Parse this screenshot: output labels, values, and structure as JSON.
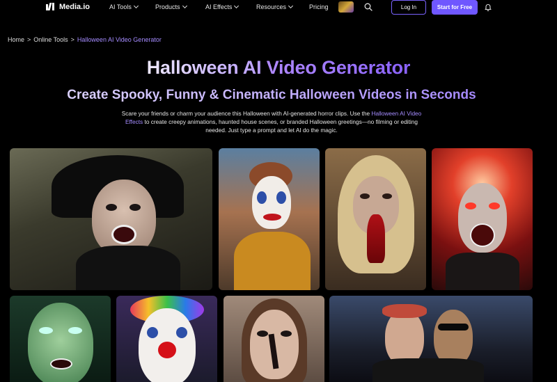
{
  "nav": {
    "brand": "Media.io",
    "items": [
      {
        "label": "AI Tools",
        "dropdown": true
      },
      {
        "label": "Products",
        "dropdown": true
      },
      {
        "label": "AI Effects",
        "dropdown": true
      },
      {
        "label": "Resources",
        "dropdown": true
      },
      {
        "label": "Pricing",
        "dropdown": false
      }
    ],
    "login_label": "Log In",
    "start_label": "Start for Free"
  },
  "breadcrumb": {
    "home": "Home",
    "sep": ">",
    "section": "Online Tools",
    "current": "Halloween AI Video Generator"
  },
  "hero": {
    "title_part1": "Halloween AI ",
    "title_part2": "Video Generator",
    "subtitle": "Create Spooky, Funny & Cinematic Halloween Videos in Seconds",
    "desc_before": "Scare your friends or charm your audience this Halloween with AI-generated horror clips. Use the ",
    "desc_link": "Halloween AI Video Effects",
    "desc_after": " to create creepy animations, haunted house scenes, or branded Halloween greetings—no filming or editing needed. Just type a prompt and let AI do the magic."
  },
  "colors": {
    "accent": "#6f57ff",
    "link": "#a58cff",
    "background": "#000000"
  },
  "gallery": [
    {
      "name": "witch-selfie"
    },
    {
      "name": "clown-makeup-woman"
    },
    {
      "name": "zombie-blonde"
    },
    {
      "name": "vampire-scream"
    },
    {
      "name": "green-witch"
    },
    {
      "name": "rainbow-clown"
    },
    {
      "name": "cracked-face-woman"
    },
    {
      "name": "two-women-street"
    }
  ]
}
